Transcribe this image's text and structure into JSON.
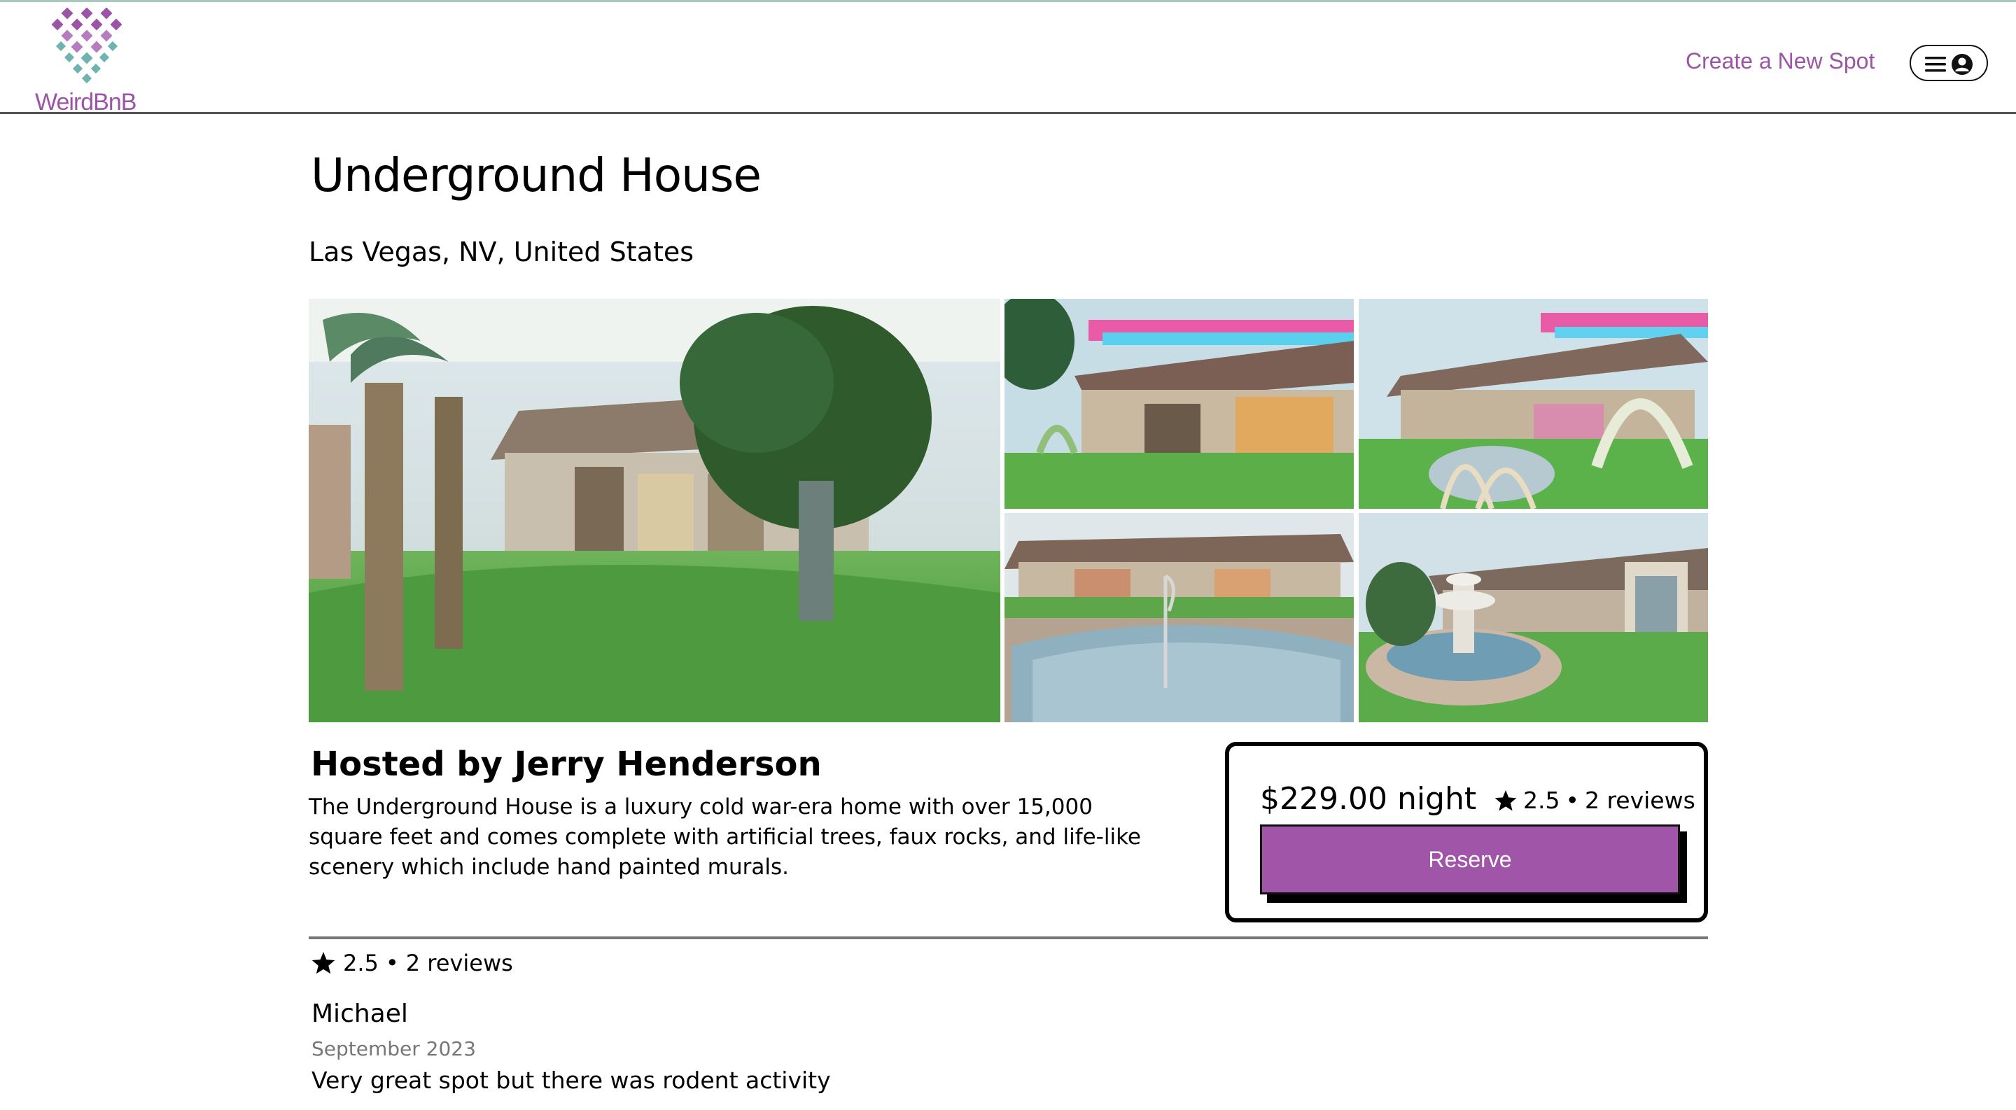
{
  "app": {
    "brand": "WeirdBnB",
    "accent": "#9b54a6",
    "button_color": "#a055a8"
  },
  "header": {
    "create_label": "Create a New Spot",
    "menu_icons": [
      "menu-icon",
      "user-circle-icon"
    ]
  },
  "spot": {
    "title": "Underground House",
    "location": "Las Vegas, NV, United States",
    "images": [
      "underground-house-main",
      "patio-neon-lights",
      "garden-dining-arch",
      "indoor-pool",
      "fountain-courtyard"
    ],
    "hosted_by": "Hosted by Jerry Henderson",
    "description": "The Underground House is a luxury cold war-era home with over 15,000 square feet and comes complete with artificial trees, faux rocks, and life-like scenery which include hand painted murals."
  },
  "booking": {
    "price": "$229.00 night",
    "rating": "2.5",
    "separator": "•",
    "reviews_count": "2 reviews",
    "reserve_label": "Reserve"
  },
  "reviews_section": {
    "rating": "2.5",
    "separator": "•",
    "reviews_count": "2 reviews",
    "items": [
      {
        "name": "Michael",
        "date": "September 2023",
        "text": "Very great spot but there was rodent activity"
      }
    ]
  }
}
